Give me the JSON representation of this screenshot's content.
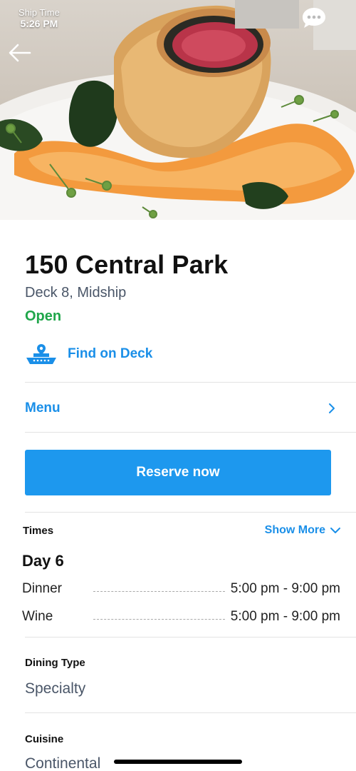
{
  "status_bar": {
    "label": "Ship Time",
    "time": "5:26 PM"
  },
  "venue": {
    "title": "150 Central Park",
    "location": "Deck 8, Midship",
    "status": "Open"
  },
  "actions": {
    "find_on_deck": "Find on Deck",
    "menu": "Menu",
    "reserve": "Reserve now"
  },
  "times": {
    "heading": "Times",
    "show_more": "Show More",
    "day": "Day 6",
    "rows": [
      {
        "name": "Dinner",
        "hours": "5:00 pm - 9:00 pm"
      },
      {
        "name": "Wine",
        "hours": "5:00 pm - 9:00 pm"
      }
    ]
  },
  "details": {
    "dining_type_label": "Dining Type",
    "dining_type_value": "Specialty",
    "cuisine_label": "Cuisine",
    "cuisine_value": "Continental"
  },
  "icons": {
    "back": "arrow-left-icon",
    "chat": "chat-bubble-icon",
    "ship": "ship-location-icon",
    "menu_chevron": "chevron-right-icon",
    "show_more_chevron": "chevron-down-icon"
  },
  "colors": {
    "accent": "#1a8fe8",
    "button": "#1d98ee",
    "open": "#1fa64a",
    "secondary_text": "#4a5668"
  }
}
